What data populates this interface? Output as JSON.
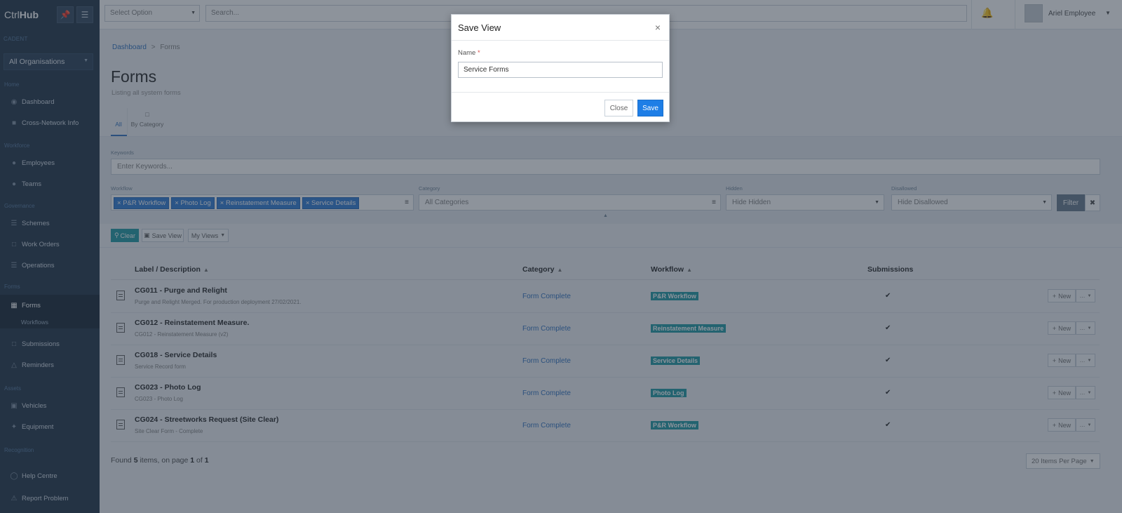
{
  "brand": {
    "part1": "Ctrl",
    "part2": "Hub"
  },
  "sidebar": {
    "org_label": "CADENT",
    "org_select": "All Organisations",
    "sections": {
      "home": "Home",
      "workforce": "Workforce",
      "governance": "Governance",
      "forms": "Forms",
      "assets": "Assets",
      "recognition": "Recognition"
    },
    "items": {
      "dashboard": "Dashboard",
      "cross_network": "Cross-Network Info",
      "employees": "Employees",
      "teams": "Teams",
      "schemes": "Schemes",
      "work_orders": "Work Orders",
      "operations": "Operations",
      "forms": "Forms",
      "workflows": "Workflows",
      "submissions": "Submissions",
      "reminders": "Reminders",
      "vehicles": "Vehicles",
      "equipment": "Equipment",
      "help_centre": "Help Centre",
      "report_problem": "Report Problem"
    }
  },
  "topbar": {
    "select_placeholder": "Select Option",
    "search_placeholder": "Search...",
    "user_name": "Ariel Employee"
  },
  "breadcrumb": {
    "home": "Dashboard",
    "sep": ">",
    "current": "Forms"
  },
  "page": {
    "title": "Forms",
    "subtitle": "Listing all system forms"
  },
  "tabs": {
    "all": "All",
    "by_category": "By Category"
  },
  "filters": {
    "keywords_label": "Keywords",
    "keywords_placeholder": "Enter Keywords...",
    "workflow_label": "Workflow",
    "workflow_chips": [
      "P&R Workflow",
      "Photo Log",
      "Reinstatement Measure",
      "Service Details"
    ],
    "category_label": "Category",
    "category_value": "All Categories",
    "hidden_label": "Hidden",
    "hidden_value": "Hide Hidden",
    "disallowed_label": "Disallowed",
    "disallowed_value": "Hide Disallowed",
    "filter_btn": "Filter"
  },
  "toolbar": {
    "clear": "Clear",
    "save_view": "Save View",
    "my_views": "My Views"
  },
  "table": {
    "headers": {
      "label": "Label / Description",
      "category": "Category",
      "workflow": "Workflow",
      "submissions": "Submissions"
    },
    "new_label": "New",
    "rows": [
      {
        "label": "CG011 - Purge and Relight",
        "desc": "Purge and Relight Merged. For production deployment 27/02/2021.",
        "category": "Form Complete",
        "workflow": "P&R Workflow"
      },
      {
        "label": "CG012 - Reinstatement Measure.",
        "desc": "CG012 - Reinstatement Measure (v2)",
        "category": "Form Complete",
        "workflow": "Reinstatement Measure"
      },
      {
        "label": "CG018 - Service Details",
        "desc": "Service Record form",
        "category": "Form Complete",
        "workflow": "Service Details"
      },
      {
        "label": "CG023 - Photo Log",
        "desc": "CG023 - Photo Log",
        "category": "Form Complete",
        "workflow": "Photo Log"
      },
      {
        "label": "CG024 - Streetworks Request (Site Clear)",
        "desc": "Site Clear Form - Complete",
        "category": "Form Complete",
        "workflow": "P&R Workflow"
      }
    ]
  },
  "pagination": {
    "found_prefix": "Found",
    "count": "5",
    "items_text": "items, on page",
    "page": "1",
    "of": "of",
    "total": "1",
    "per_page": "20 Items Per Page"
  },
  "modal": {
    "title": "Save View",
    "name_label": "Name",
    "required_mark": "*",
    "name_value": "Service Forms",
    "close_btn": "Close",
    "save_btn": "Save"
  }
}
